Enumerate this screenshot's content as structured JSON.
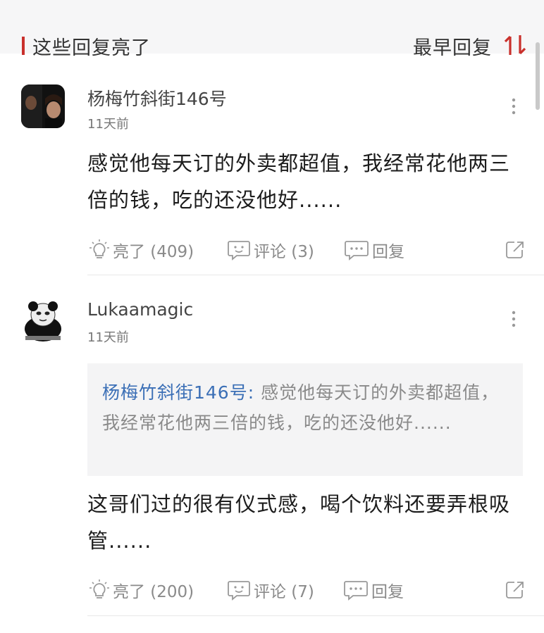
{
  "section": {
    "title": "这些回复亮了",
    "sort_label": "最早回复"
  },
  "comments": [
    {
      "author": "杨梅竹斜街146号",
      "time": "11天前",
      "content": "感觉他每天订的外卖都超值，我经常花他两三倍的钱，吃的还没他好......",
      "actions": {
        "light": "亮了 (409)",
        "comment": "评论 (3)",
        "reply": "回复"
      }
    },
    {
      "author": "Lukaamagic",
      "time": "11天前",
      "quote": {
        "author": "杨梅竹斜街146号:",
        "text": " 感觉他每天订的外卖都超值，我经常花他两三倍的钱，吃的还没他好......"
      },
      "content": "这哥们过的很有仪式感，喝个饮料还要弄根吸管......",
      "actions": {
        "light": "亮了 (200)",
        "comment": "评论 (7)",
        "reply": "回复"
      }
    }
  ],
  "colors": {
    "accent": "#c9302c",
    "link": "#3b6fb6",
    "header_bg": "#f6f6f7",
    "quote_bg": "#f4f4f5"
  }
}
